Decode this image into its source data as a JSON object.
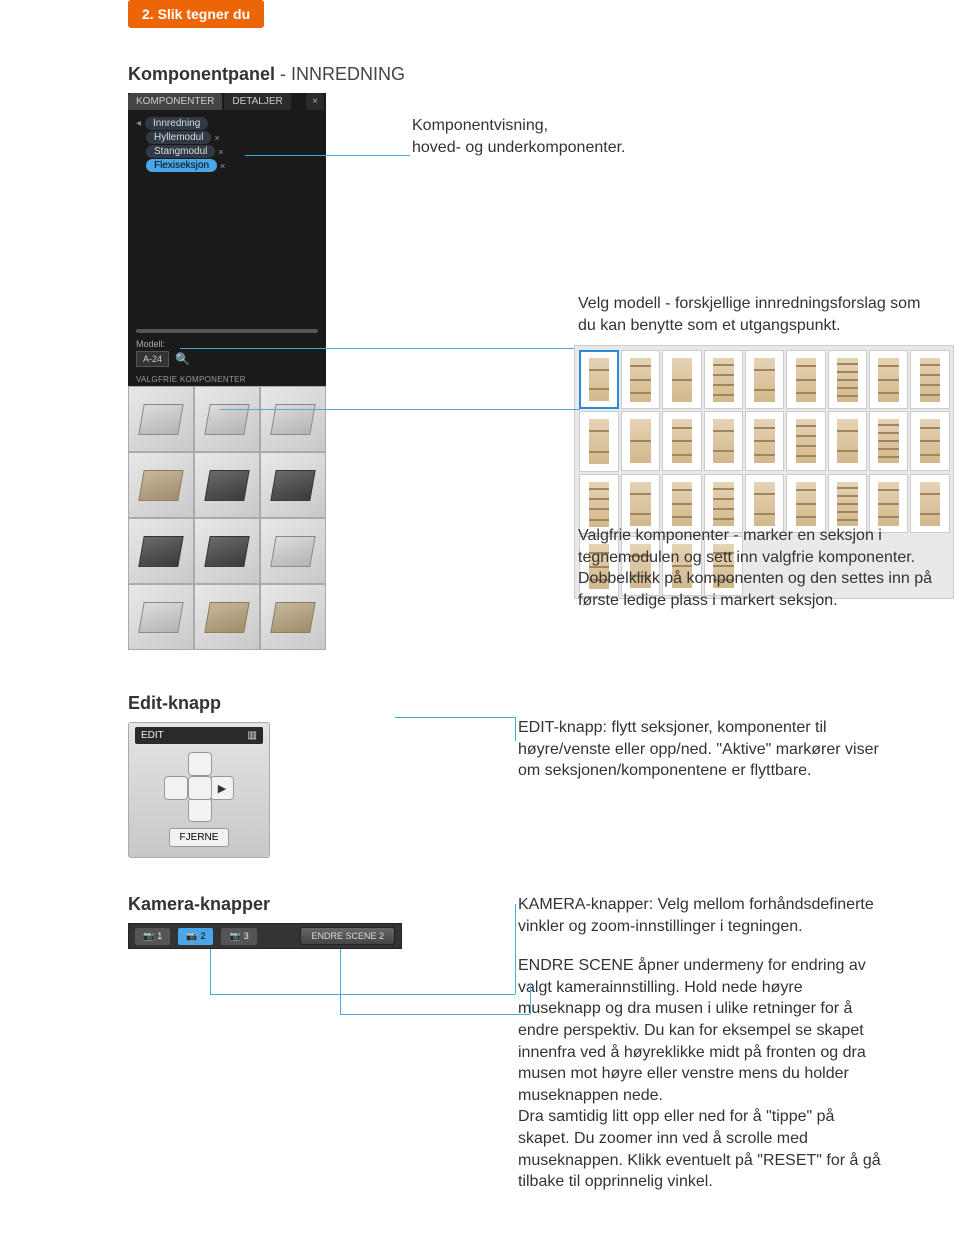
{
  "header": {
    "section_tag": "2. Slik tegner du",
    "title_bold": "Komponentpanel",
    "title_light": "  -  INNREDNING"
  },
  "panel": {
    "tabs": [
      "KOMPONENTER",
      "DETALJER"
    ],
    "close_glyph": "×",
    "tree": {
      "root": "Innredning",
      "items": [
        "Hyllemodul",
        "Stangmodul",
        "Flexiseksjon"
      ]
    },
    "model_label": "Modell:",
    "model_value": "A-24",
    "optional_label": "VALGFRIE KOMPONENTER"
  },
  "annotations": {
    "view": "Komponentvisning,\nhoved- og underkomponenter.",
    "model": "Velg modell - forskjellige innredningsforslag som du kan benytte som et utgangspunkt.",
    "optional": "Valgfrie komponenter - marker en seksjon i tegnemodulen og sett inn valgfrie komponenter. Dobbelklikk på komponenten og den settes inn på første ledige plass i markert seksjon."
  },
  "edit": {
    "heading": "Edit-knapp",
    "title": "EDIT",
    "remove_label": "FJERNE",
    "description": "EDIT-knapp:  flytt seksjoner, komponenter til høyre/venste eller opp/ned. \"Aktive\" markører viser om seksjonen/komponentene er flyttbare."
  },
  "camera": {
    "heading": "Kamera-knapper",
    "buttons": [
      "1",
      "2",
      "3"
    ],
    "scene_btn": "ENDRE SCENE 2",
    "description": "KAMERA-knapper: Velg mellom forhåndsdefinerte vinkler og zoom-innstillinger i tegningen.",
    "scene_description": "ENDRE SCENE åpner undermeny for endring av valgt kamerainnstilling. Hold nede høyre museknapp og dra musen i ulike retninger for å endre perspektiv. Du kan for eksempel se skapet innenfra ved å høyreklikke midt på fronten og dra musen mot høyre eller venstre mens du holder museknappen nede.\nDra samtidig litt opp eller ned for å \"tippe\" på skapet. Du zoomer inn ved å scrolle med museknappen. Klikk eventuelt på \"RESET\" for å gå tilbake til opprinnelig vinkel."
  }
}
